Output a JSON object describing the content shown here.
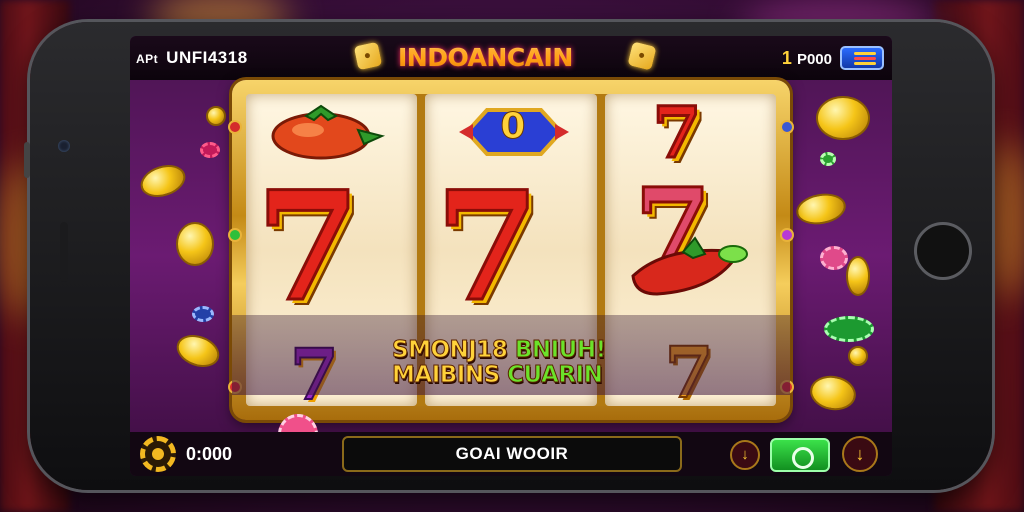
{
  "header": {
    "player_prefix": "APt",
    "player_name": "UNFI4318",
    "logo_text": "INDOANCAIN",
    "balance_value": "1",
    "balance_suffix": "P000",
    "menu_icon": "menu-icon"
  },
  "reels": [
    {
      "symbols": [
        "tomato-fruit",
        "seven",
        "seven-grape"
      ]
    },
    {
      "symbols": [
        "gem-zero",
        "seven",
        "bonus-text"
      ]
    },
    {
      "symbols": [
        "seven",
        "seven-chili",
        "seven-small"
      ]
    }
  ],
  "center_zero": "0",
  "win_banner": {
    "line1_yellow": "SMONJ18 ",
    "line1_green": "BNIUH!",
    "line2_yellow": "MAIBINS ",
    "line2_green": "CUARIN"
  },
  "footer": {
    "settings_icon": "gear-icon",
    "credit": "0:000",
    "bet_label": "GOAI WOOIR",
    "minus_icon": "arrow-down-icon",
    "spin_icon": "spin-icon",
    "auto_icon": "chevron-icon"
  },
  "colors": {
    "accent_gold": "#f2b821",
    "brand_red": "#e3241b",
    "spin_green": "#3be14a",
    "background_purple": "#6b1b72"
  }
}
